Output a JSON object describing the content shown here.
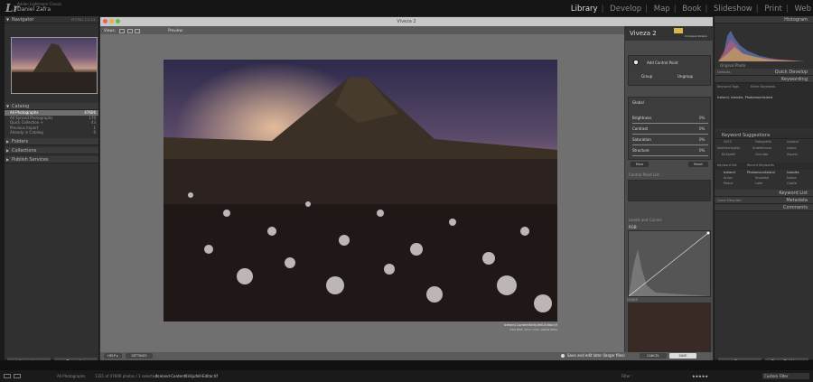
{
  "app": {
    "lr_badge": "Lr",
    "product": "Adobe Lightroom Classic",
    "user": "Daniel Zafra",
    "modules": [
      "Library",
      "Develop",
      "Map",
      "Book",
      "Slideshow",
      "Print",
      "Web"
    ],
    "active_module": "Library"
  },
  "left_panel": {
    "navigator": "Navigator",
    "nav_zoom": [
      "FIT",
      "FILL",
      "1:1",
      "3:1"
    ],
    "catalog": "Catalog",
    "catalog_items": [
      {
        "label": "All Photographs",
        "count": "47606"
      },
      {
        "label": "All Synced Photographs",
        "count": "170"
      },
      {
        "label": "Quick Collection +",
        "count": "43"
      },
      {
        "label": "Previous Import",
        "count": "1"
      },
      {
        "label": "Already in Catalog",
        "count": "0"
      }
    ],
    "folders": "Folders",
    "collections": "Collections",
    "publish": "Publish Services",
    "import_btn": "Import...",
    "export_btn": "Export..."
  },
  "plugin_window": {
    "title": "Viveza 2",
    "views_label": "Views:",
    "preview_label": "Preview:",
    "panel_title": "Viveza 2",
    "compare_label": "Compare Sliders",
    "add_control_point": "Add Control Point",
    "group": "Group",
    "ungroup": "Ungroup",
    "global_label": "Global",
    "sliders": [
      {
        "name": "Brightness",
        "value": "0%"
      },
      {
        "name": "Contrast",
        "value": "0%"
      },
      {
        "name": "Saturation",
        "value": "0%"
      },
      {
        "name": "Structure",
        "value": "0%"
      }
    ],
    "more_btn": "More",
    "reset_btn": "Reset",
    "control_point_list": "Control Point List",
    "levels_curves": "Levels and Curves",
    "rgb_label": "RGB",
    "loupe_label": "Loupe",
    "caption_file": "Iceland-ContentKirkjufell-Editar.tif",
    "caption_meta": "ORG BMP, 3072 7032, NIKON D850",
    "help_btn": "HELP ▸",
    "settings_btn": "SETTINGS",
    "save_label": "Save and edit later (larger files)",
    "cancel_btn": "CANCEL",
    "save_btn": "SAVE"
  },
  "right_panel": {
    "histogram": "Histogram",
    "original_photo": "Original Photo",
    "defaults": "Defaults",
    "quick_develop": "Quick Develop",
    "keywording": "Keywording",
    "keyword_tags": "Keyword Tags",
    "enter_keywords": "Enter Keywords",
    "keywords_value": "Iceland, islandia, Photomountsland",
    "keyword_suggestions": "Keyword Suggestions",
    "suggestions": [
      "2013",
      "Fotografía",
      "Iceland",
      "Northernlights",
      "Snæfellsnes",
      "Island",
      "Kirkjufell",
      "Grundar",
      "Aspect"
    ],
    "keyword_set": "Keyword Set",
    "recent_keywords": "Recent Keywords",
    "recent": [
      "Iceland",
      "Photomountsland",
      "Islandia",
      "Arctic",
      "Snowfall",
      "Ísland",
      "Peace",
      "Lake",
      "Castle"
    ],
    "keyword_list": "Keyword List",
    "quick_describe": "Quick Describe",
    "metadata": "Metadata",
    "comments": "Comments",
    "sync": "Sync",
    "sync_settings": "Sync Settings"
  },
  "filmstrip": {
    "all_photos": "All Photographs",
    "status": "1321 of 47606 photos / 1 selected",
    "filename": "/Iceland-ContentKirkjufell-Editar.tif",
    "filter_label": "Filter :",
    "custom_filter": "Custom Filter"
  },
  "colors": {
    "accent": "#d9b64a",
    "bg": "#1b1b1b"
  }
}
